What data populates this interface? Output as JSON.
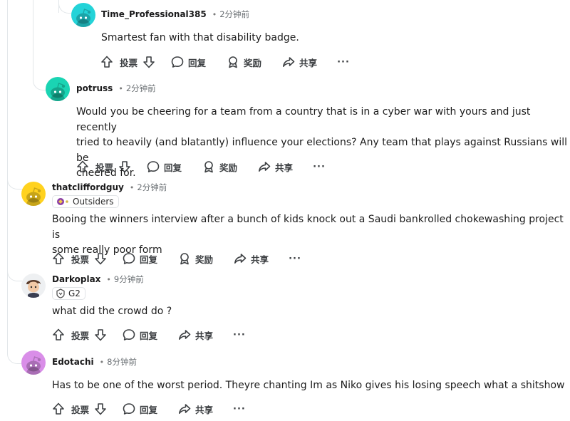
{
  "comments": [
    {
      "author": "Time_Professional385",
      "time": "2分钟前",
      "body": "Smartest fan with that disability badge.",
      "actions": {
        "vote": "投票",
        "reply": "回复",
        "award": "奖励",
        "share": "共享",
        "more": "···"
      },
      "avatar_color": "#24d3d8"
    },
    {
      "author": "potruss",
      "time": "2分钟前",
      "body_lines": [
        "Would you be cheering for a team from a country that is in a cyber war with yours and just recently",
        "tried to heavily (and blatantly) influence your elections? Any team that plays against Russians will be",
        "cheered for."
      ],
      "actions": {
        "vote": "投票",
        "reply": "回复",
        "award": "奖励",
        "share": "共享",
        "more": "···"
      },
      "avatar_color": "#1ad4b3"
    },
    {
      "author": "thatcliffordguy",
      "time": "2分钟前",
      "flair": "Outsiders",
      "body_lines": [
        "Booing the winners interview after a bunch of kids knock out a Saudi bankrolled chokewashing project is",
        "some really poor form"
      ],
      "actions": {
        "vote": "投票",
        "reply": "回复",
        "award": "奖励",
        "share": "共享",
        "more": "···"
      },
      "avatar_color": "#ffd21f"
    },
    {
      "author": "Darkoplax",
      "time": "9分钟前",
      "flair": "G2",
      "body": "what did the crowd do ?",
      "actions": {
        "vote": "投票",
        "reply": "回复",
        "share": "共享",
        "more": "···"
      }
    },
    {
      "author": "Edotachi",
      "time": "8分钟前",
      "body": "Has to be one of the worst period. Theyre chanting Im as Niko gives his losing speech what a shitshow",
      "actions": {
        "vote": "投票",
        "reply": "回复",
        "share": "共享",
        "more": "···"
      },
      "avatar_color": "#d98ee8"
    }
  ]
}
